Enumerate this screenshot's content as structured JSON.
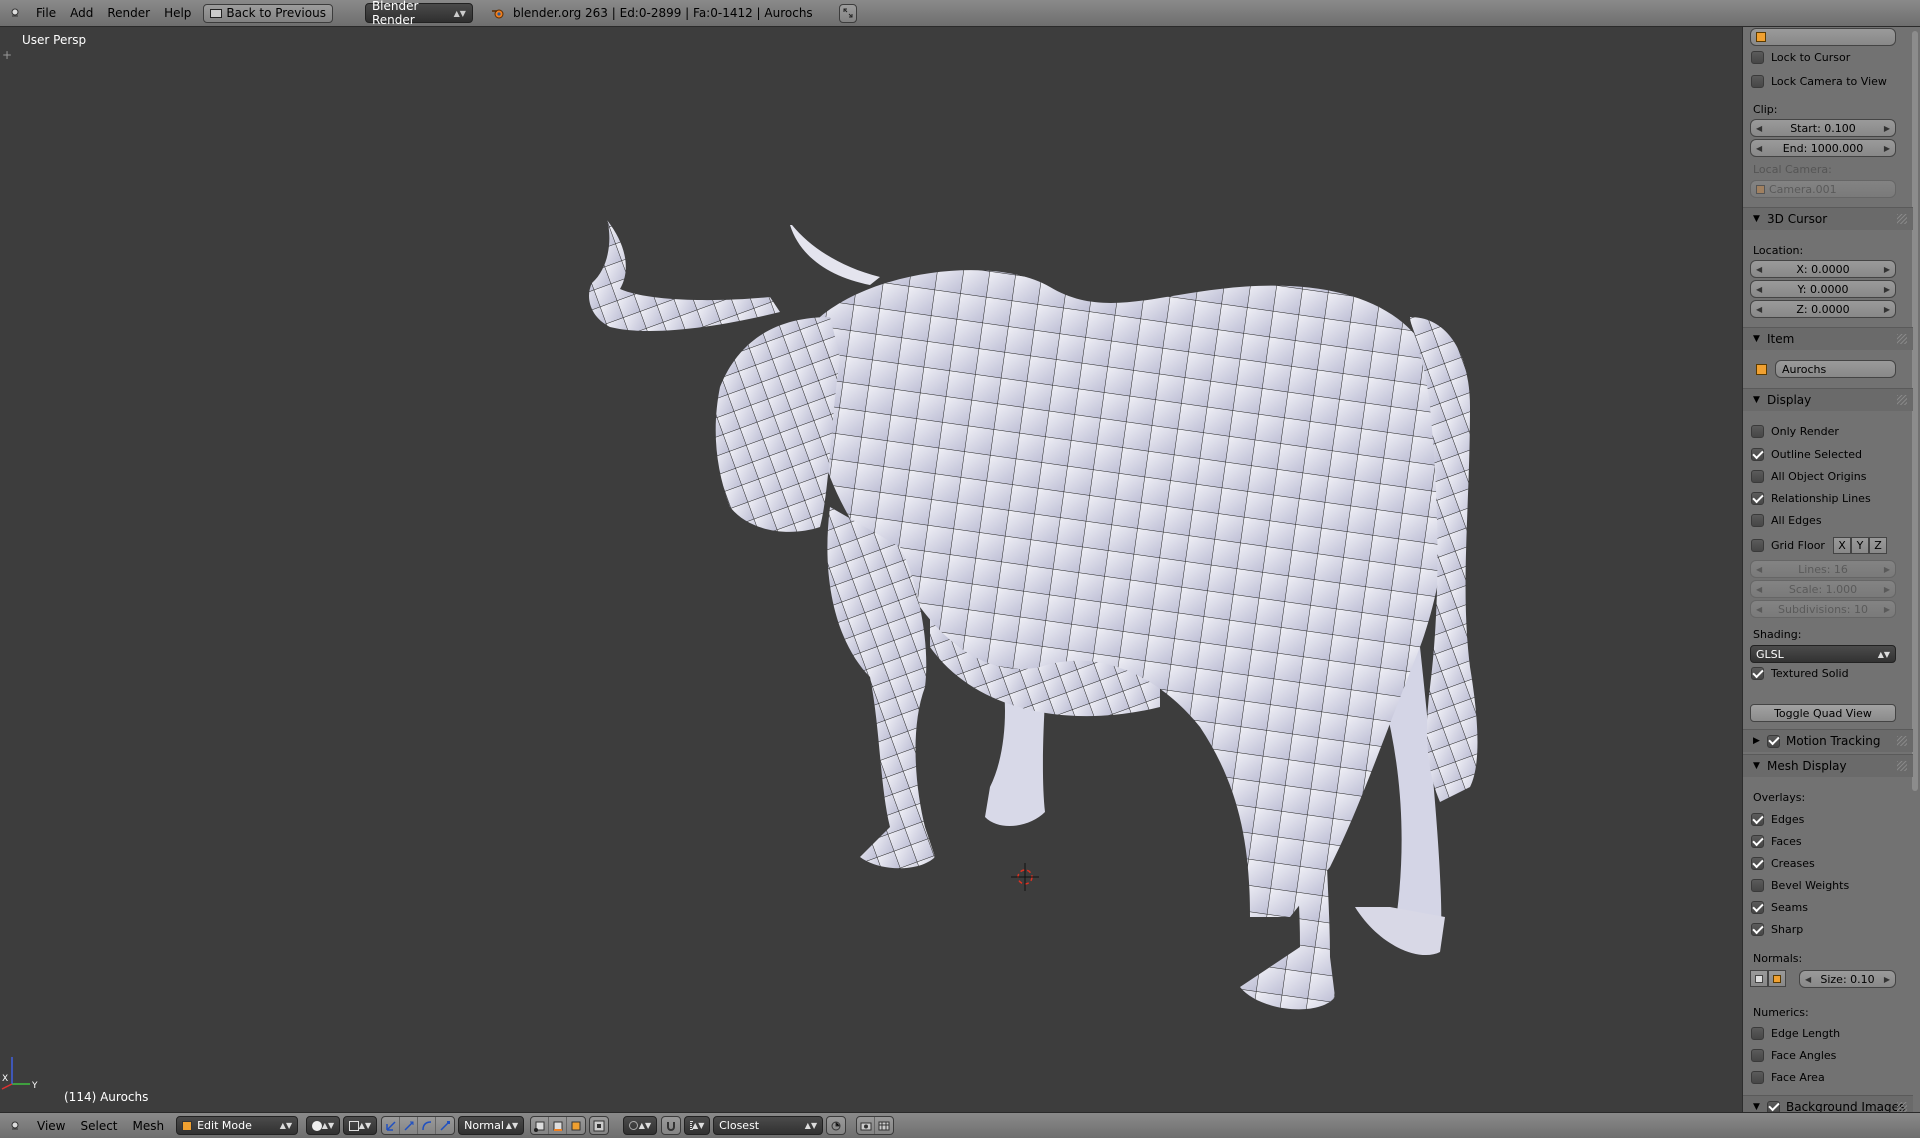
{
  "header": {
    "menus": [
      "File",
      "Add",
      "Render",
      "Help"
    ],
    "back_button": "Back to Previous",
    "render_engine": "Blender Render",
    "stats": "blender.org 263 | Ed:0-2899 | Fa:0-1412 | Aurochs"
  },
  "viewport": {
    "view_label": "User Persp",
    "object_label": "(114) Aurochs"
  },
  "panel": {
    "lock_to_cursor": "Lock to Cursor",
    "lock_camera_to_view": "Lock Camera to View",
    "clip_label": "Clip:",
    "clip_start": "Start: 0.100",
    "clip_end": "End: 1000.000",
    "local_camera_label": "Local Camera:",
    "local_camera": "Camera.001",
    "cursor_section": "3D Cursor",
    "location_label": "Location:",
    "cursor_x": "X: 0.0000",
    "cursor_y": "Y: 0.0000",
    "cursor_z": "Z: 0.0000",
    "item_section": "Item",
    "item_name": "Aurochs",
    "display_section": "Display",
    "only_render": "Only Render",
    "outline_selected": "Outline Selected",
    "all_object_origins": "All Object Origins",
    "relationship_lines": "Relationship Lines",
    "all_edges": "All Edges",
    "grid_floor": "Grid Floor",
    "axis_x": "X",
    "axis_y": "Y",
    "axis_z": "Z",
    "lines": "Lines: 16",
    "scale": "Scale: 1.000",
    "subdivisions": "Subdivisions: 10",
    "shading_label": "Shading:",
    "shading_value": "GLSL",
    "textured_solid": "Textured Solid",
    "toggle_quad_view": "Toggle Quad View",
    "motion_tracking": "Motion Tracking",
    "mesh_display": "Mesh Display",
    "overlays_label": "Overlays:",
    "edges": "Edges",
    "faces": "Faces",
    "creases": "Creases",
    "bevel_weights": "Bevel Weights",
    "seams": "Seams",
    "sharp": "Sharp",
    "normals_label": "Normals:",
    "normals_size": "Size: 0.10",
    "numerics_label": "Numerics:",
    "edge_length": "Edge Length",
    "face_angles": "Face Angles",
    "face_area": "Face Area",
    "background_images": "Background Images"
  },
  "footer": {
    "menus": [
      "View",
      "Select",
      "Mesh"
    ],
    "mode": "Edit Mode",
    "orientation": "Normal",
    "snap": "Closest"
  },
  "colors": {
    "viewport_bg": "#3d3d3d",
    "mesh_fill": "#e2e2ec",
    "panel_bg": "#727272",
    "cursor_red": "#e03020"
  }
}
